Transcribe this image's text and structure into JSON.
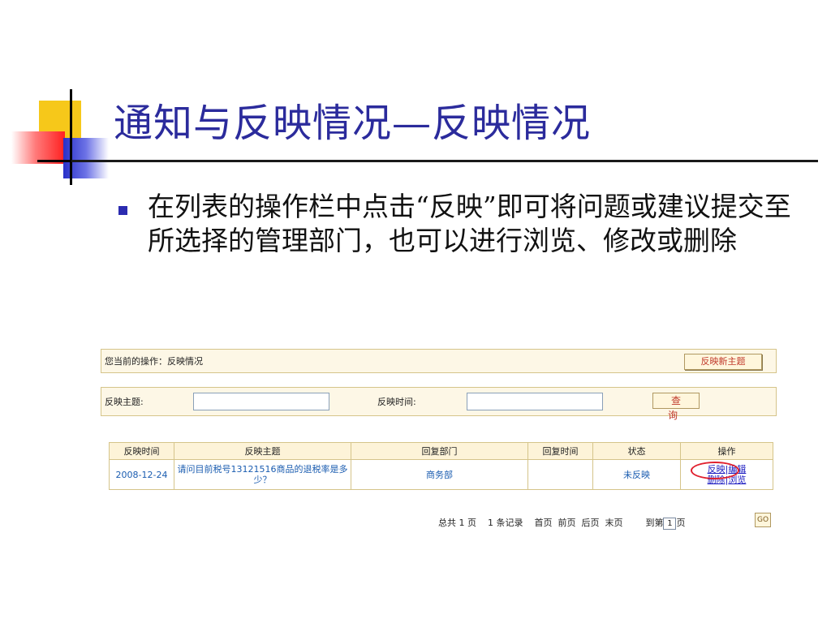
{
  "slide": {
    "title": "通知与反映情况—反映情况",
    "bullet": "在列表的操作栏中点击“反映”即可将问题或建议提交至所选择的管理部门，也可以进行浏览、修改或删除"
  },
  "app": {
    "current_op_label": "您当前的操作：反映情况",
    "new_topic_button": "反映新主题",
    "search": {
      "topic_label": "反映主题:",
      "topic_value": "",
      "time_label": "反映时间:",
      "time_value": "",
      "query_button": "查 询"
    },
    "table": {
      "headers": [
        "反映时间",
        "反映主题",
        "回复部门",
        "回复时间",
        "状态",
        "操作"
      ],
      "rows": [
        {
          "time": "2008-12-24",
          "topic": "请问目前税号13121516商品的退税率是多少？",
          "dept": "商务部",
          "reply_time": "",
          "status": "未反映",
          "ops": {
            "reflect": "反映",
            "edit": "编辑",
            "delete": "删除",
            "browse": "浏览",
            "sep": "|"
          }
        }
      ]
    },
    "pager": {
      "total_pages": "总共 1 页",
      "records": "1 条记录",
      "first": "首页",
      "prev": "前页",
      "next": "后页",
      "last": "末页",
      "goto_label": "到第",
      "goto_value": "1",
      "page_suffix": "页",
      "go_button": "GO"
    }
  }
}
